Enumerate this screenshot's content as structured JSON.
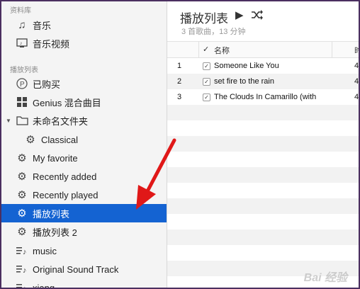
{
  "sidebar": {
    "library_header": "资料库",
    "library_items": [
      {
        "label": "音乐",
        "icon": "music-note-icon"
      },
      {
        "label": "音乐视频",
        "icon": "music-video-icon"
      }
    ],
    "playlists_header": "播放列表",
    "playlist_items": [
      {
        "label": "已购买",
        "icon": "purchased-icon"
      },
      {
        "label": "Genius 混合曲目",
        "icon": "genius-grid-icon"
      },
      {
        "label": "未命名文件夹",
        "icon": "folder-icon"
      },
      {
        "label": "Classical",
        "icon": "gear-icon"
      },
      {
        "label": "My favorite",
        "icon": "gear-icon"
      },
      {
        "label": "Recently added",
        "icon": "gear-icon"
      },
      {
        "label": "Recently played",
        "icon": "gear-icon"
      },
      {
        "label": "播放列表",
        "icon": "gear-icon"
      },
      {
        "label": "播放列表 2",
        "icon": "gear-icon"
      },
      {
        "label": "music",
        "icon": "playlist-icon"
      },
      {
        "label": "Original Sound Track",
        "icon": "playlist-icon"
      },
      {
        "label": "xiang",
        "icon": "playlist-icon"
      }
    ]
  },
  "main": {
    "title": "播放列表",
    "play_icon": "play-icon",
    "shuffle_icon": "shuffle-icon",
    "subtitle": "3 首歌曲，13 分钟",
    "columns": {
      "check": "✓",
      "name": "名称",
      "time": "时"
    },
    "rows": [
      {
        "index": "1",
        "name": "Someone Like You",
        "time": "4"
      },
      {
        "index": "2",
        "name": "set fire to the rain",
        "time": "4"
      },
      {
        "index": "3",
        "name": "The Clouds In Camarillo (with",
        "time": "4"
      }
    ]
  },
  "watermark": "Bai 经验",
  "colors": {
    "selection": "#1463d2",
    "arrow": "#e01818"
  }
}
